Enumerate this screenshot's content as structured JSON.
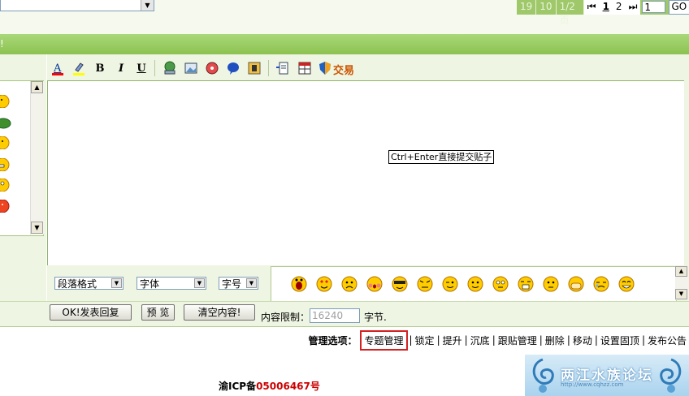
{
  "pagination": {
    "pages": [
      "19",
      "10",
      "1/2页"
    ],
    "first_icon": "first-page-icon",
    "current": "1",
    "next": "2",
    "last_icon": "last-page-icon",
    "jump_value": "1",
    "go_label": "GO"
  },
  "green_bar": {
    "text": "!"
  },
  "toolbar": {
    "icons": [
      "font-color-icon",
      "highlight-icon",
      "bold-icon",
      "italic-icon",
      "underline-icon",
      "link-icon",
      "image-icon",
      "media-icon",
      "flash-icon",
      "code-icon",
      "paste-icon",
      "table-icon",
      "trade-shield-icon"
    ],
    "bold": "B",
    "italic": "I",
    "underline": "U",
    "font_color": "A",
    "trade_label": "交易"
  },
  "editor": {
    "hint": "Ctrl+Enter直接提交贴子"
  },
  "format": {
    "paragraph": "段落格式",
    "font": "字体",
    "size": "字号"
  },
  "buttons": {
    "submit": "OK!发表回复",
    "preview": "预 览",
    "clear": "清空内容!"
  },
  "limit": {
    "label": "内容限制：",
    "value": "16240",
    "unit": "字节."
  },
  "admin": {
    "label": "管理选项：",
    "options": [
      "专题管理",
      "锁定",
      "提升",
      "沉底",
      "跟贴管理",
      "删除",
      "移动",
      "设置固顶",
      "发布公告"
    ]
  },
  "footer": {
    "icp_prefix": "渝ICP备",
    "icp_number": "05006467号"
  },
  "logo": {
    "text": "两江水族论坛",
    "sub": "http://www.cqhzz.com"
  },
  "colors": {
    "green_bar": "#9ccf66",
    "panel_bg": "#eef5e2",
    "highlight_border": "#d42020",
    "icp_number": "#cc0000"
  }
}
